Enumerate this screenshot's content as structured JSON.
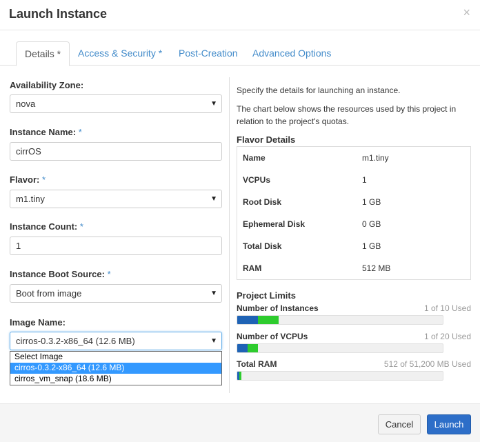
{
  "header": {
    "title": "Launch Instance",
    "close": "×"
  },
  "tabs": [
    {
      "label": "Details *",
      "active": true
    },
    {
      "label": "Access & Security *",
      "active": false
    },
    {
      "label": "Post-Creation",
      "active": false
    },
    {
      "label": "Advanced Options",
      "active": false
    }
  ],
  "form": {
    "availability_zone": {
      "label": "Availability Zone:",
      "value": "nova"
    },
    "instance_name": {
      "label": "Instance Name:",
      "req": "*",
      "value": "cirrOS"
    },
    "flavor": {
      "label": "Flavor:",
      "req": "*",
      "value": "m1.tiny"
    },
    "instance_count": {
      "label": "Instance Count:",
      "req": "*",
      "value": "1"
    },
    "boot_source": {
      "label": "Instance Boot Source:",
      "req": "*",
      "value": "Boot from image"
    },
    "image_name": {
      "label": "Image Name:",
      "value": "cirros-0.3.2-x86_64 (12.6 MB)",
      "options": [
        "Select Image",
        "cirros-0.3.2-x86_64 (12.6 MB)",
        "cirros_vm_snap (18.6 MB)"
      ]
    }
  },
  "info": {
    "help1": "Specify the details for launching an instance.",
    "help2": "The chart below shows the resources used by this project in relation to the project's quotas."
  },
  "flavor_details": {
    "title": "Flavor Details",
    "rows": [
      {
        "name": "Name",
        "value": "m1.tiny"
      },
      {
        "name": "VCPUs",
        "value": "1"
      },
      {
        "name": "Root Disk",
        "value": "1 GB"
      },
      {
        "name": "Ephemeral Disk",
        "value": "0 GB"
      },
      {
        "name": "Total Disk",
        "value": "1 GB"
      },
      {
        "name": "RAM",
        "value": "512 MB"
      }
    ]
  },
  "project_limits": {
    "title": "Project Limits",
    "items": [
      {
        "label": "Number of Instances",
        "used_text": "1 of 10 Used",
        "current_fraction": 0.1,
        "added_fraction": 0.1
      },
      {
        "label": "Number of VCPUs",
        "used_text": "1 of 20 Used",
        "current_fraction": 0.05,
        "added_fraction": 0.05
      },
      {
        "label": "Total RAM",
        "used_text": "512 of 51,200 MB Used",
        "current_fraction": 0.01,
        "added_fraction": 0.01
      }
    ]
  },
  "footer": {
    "cancel": "Cancel",
    "launch": "Launch"
  },
  "colors": {
    "link": "#428bca",
    "primary": "#2d6ec8",
    "bar_current": "#1f63b5",
    "bar_added": "#2ecc2e"
  }
}
